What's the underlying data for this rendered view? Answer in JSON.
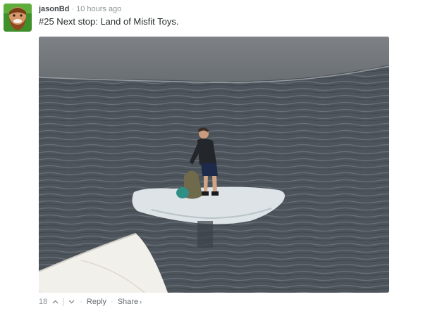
{
  "comment": {
    "author": "jasonBd",
    "separator": "·",
    "time": "10 hours ago",
    "message": "#25 Next stop: Land of Misfit Toys.",
    "avatar_icon": "bearded-man-avatar",
    "image_icon": "man-on-ice-floe-photo"
  },
  "footer": {
    "vote_count": "18",
    "upvote_icon": "chevron-up-icon",
    "downvote_icon": "chevron-down-icon",
    "dot1": "·",
    "reply_label": "Reply",
    "dot2": "·",
    "share_label": "Share",
    "share_chevron": "›"
  },
  "colors": {
    "author": "#3f4549",
    "meta": "#8c9296",
    "message": "#2a2e2e",
    "link": "#656c70"
  }
}
